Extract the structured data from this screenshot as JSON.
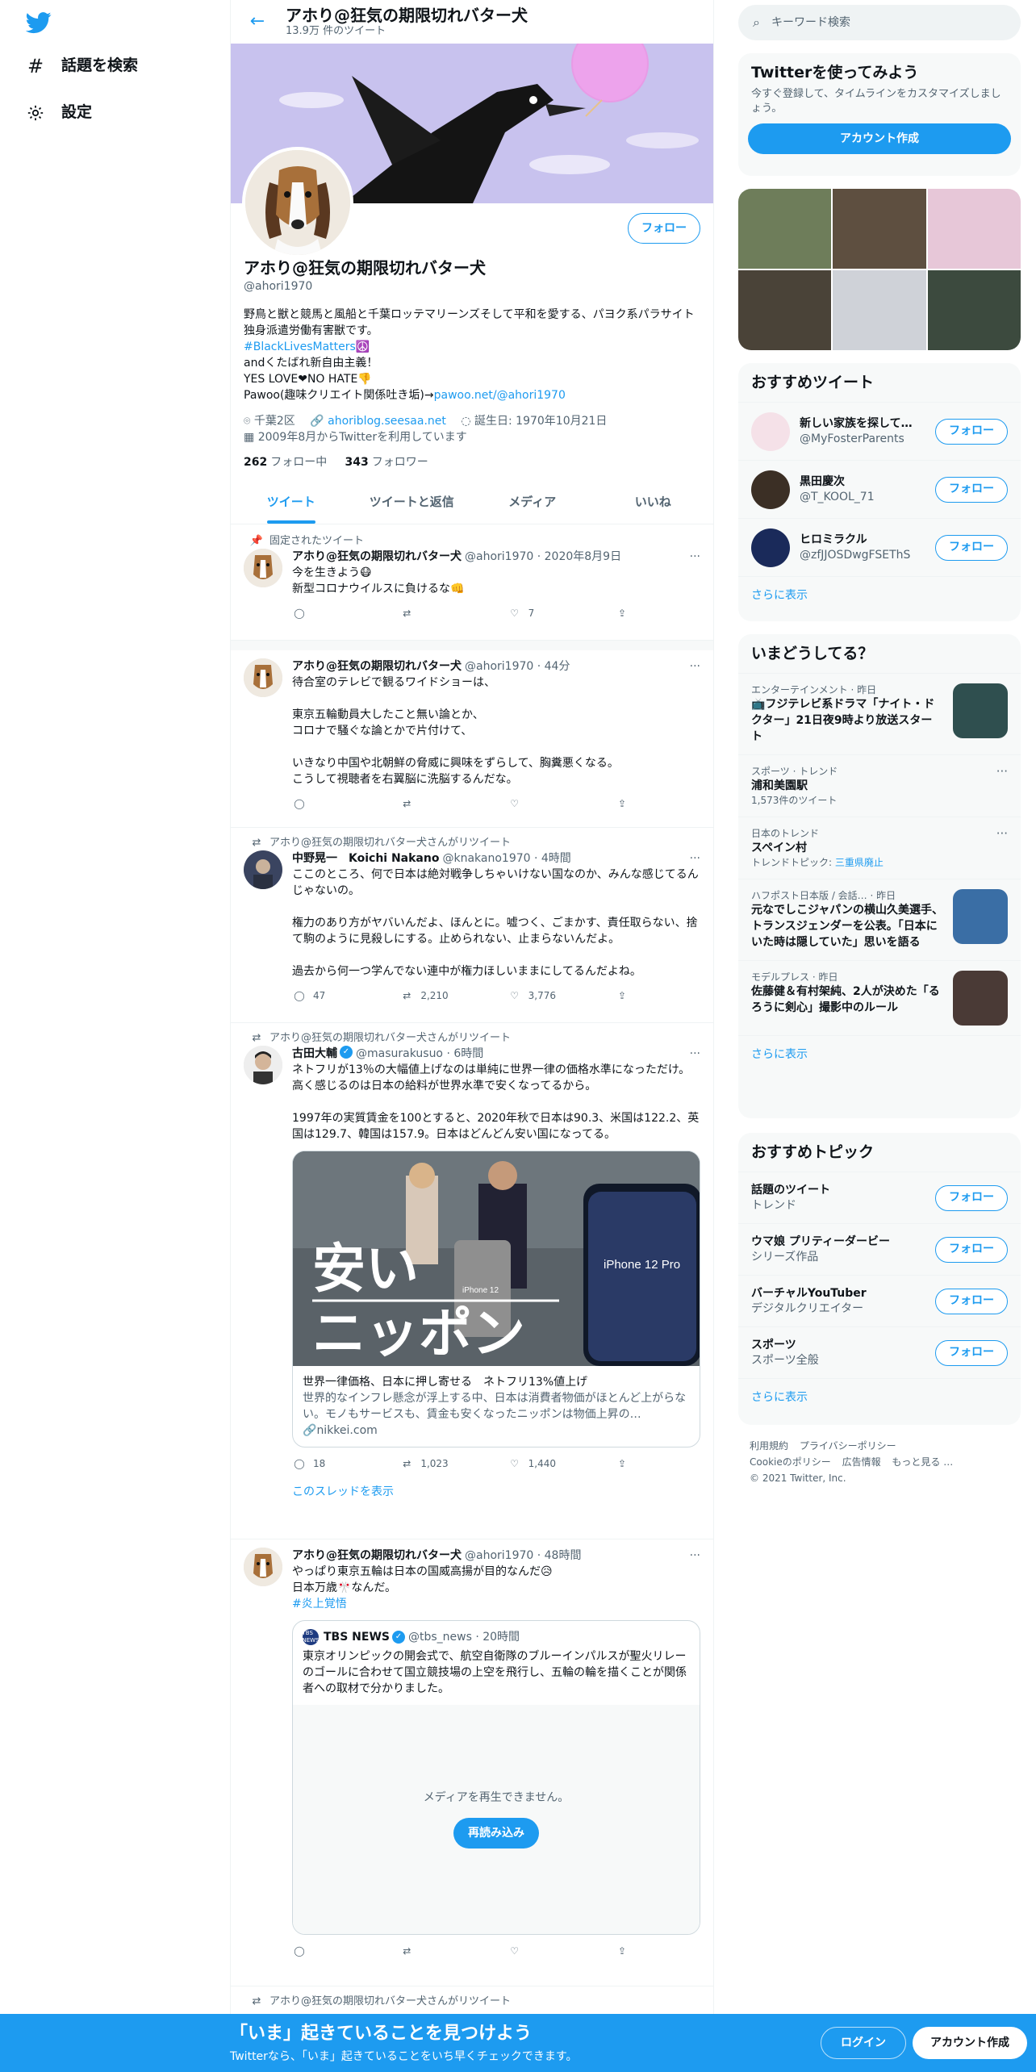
{
  "nav": {
    "explore": "話題を検索",
    "settings": "設定"
  },
  "header": {
    "title": "アホり@狂気の期限切れバター犬",
    "tweet_count": "13.9万 件のツイート"
  },
  "profile": {
    "follow": "フォロー",
    "name": "アホり@狂気の期限切れバター犬",
    "handle": "@ahori1970",
    "bio_line1": "野鳥と獣と競馬と風船と千葉ロッテマリーンズそして平和を愛する、パヨク系パラサイト独身派遣労働有害獣です。",
    "bio_hashtag": "#BlackLivesMatters☮️",
    "bio_line3": "andくたばれ新自由主義！",
    "bio_line4": "YES LOVE❤NO HATE👎",
    "bio_line5_prefix": "Pawoo(趣味クリエイト関係吐き垢)→",
    "bio_line5_link": "pawoo.net/@ahori1970",
    "location": "千葉2区",
    "website": "ahoriblog.seesaa.net",
    "birthday": "誕生日: 1970年10月21日",
    "joined": "2009年8月からTwitterを利用しています",
    "following_count": "262",
    "following_label": "フォロー中",
    "followers_count": "343",
    "followers_label": "フォロワー"
  },
  "tabs": [
    "ツイート",
    "ツイートと返信",
    "メディア",
    "いいね"
  ],
  "tweets": [
    {
      "context": "固定されたツイート",
      "name": "アホり@狂気の期限切れバター犬",
      "meta": "@ahori1970 · 2020年8月9日",
      "text": "今を生きよう😷\n新型コロナウイルスに負けるな👊",
      "reply": "",
      "retweet": "",
      "like": "7"
    },
    {
      "name": "アホり@狂気の期限切れバター犬",
      "meta": "@ahori1970 · 44分",
      "text": "待合室のテレビで観るワイドショーは、\n\n東京五輪動員大したこと無い論とか、\nコロナで騒ぐな論とかで片付けて、\n\nいきなり中国や北朝鮮の脅威に興味をずらして、胸糞悪くなる。\nこうして視聴者を右翼脳に洗脳するんだな。"
    },
    {
      "context": "アホり@狂気の期限切れバター犬さんがリツイート",
      "name": "中野晃一　Koichi Nakano",
      "meta": "@knakano1970 · 4時間",
      "text": "ここのところ、何で日本は絶対戦争しちゃいけない国なのか、みんな感じてるんじゃないの。\n\n権力のあり方がヤバいんだよ、ほんとに。嘘つく、ごまかす、責任取らない、捨て駒のように見殺しにする。止められない、止まらないんだよ。\n\n過去から何一つ学んでない連中が権力ほしいままにしてるんだよね。",
      "reply": "47",
      "retweet": "2,210",
      "like": "3,776"
    },
    {
      "context": "アホり@狂気の期限切れバター犬さんがリツイート",
      "name": "古田大輔",
      "meta": "@masurakusuo · 6時間",
      "text": "ネトフリが13％の大幅値上げなのは単純に世界一律の価格水準になっただけ。高く感じるのは日本の給料が世界水準で安くなってるから。\n\n1997年の実質賃金を100とすると、2020年秋で日本は90.3、米国は122.2、英国は129.7、韓国は157.9。日本はどんどん安い国になってる。",
      "card_overlay1": "安い",
      "card_overlay2": "ニッポン",
      "card_phone1": "iPhone 12",
      "card_phone2": "iPhone 12 Pro",
      "card_title": "世界一律価格、日本に押し寄せる　ネトフリ13%値上げ",
      "card_desc": "世界的なインフレ懸念が浮上する中、日本は消費者物価がほとんど上がらない。モノもサービスも、賃金も安くなったニッポンは物価上昇の…",
      "card_domain": "nikkei.com",
      "reply": "18",
      "retweet": "1,023",
      "like": "1,440",
      "show_thread": "このスレッドを表示"
    },
    {
      "name": "アホり@狂気の期限切れバター犬",
      "meta": "@ahori1970 · 48時間",
      "text": "やっぱり東京五輪は日本の国威高揚が目的なんだ😥\n日本万歳🎌なんだ。",
      "hashtag": "#炎上覚悟",
      "quote_avatar": "TBS NEWS",
      "quote_name": "TBS NEWS",
      "quote_meta": "@tbs_news · 20時間",
      "quote_text": "東京オリンピックの開会式で、航空自衛隊のブルーインパルスが聖火リレーのゴールに合わせて国立競技場の上空を飛行し、五輪の輪を描くことが関係者への取材で分かりました。",
      "media_error": "メディアを再生できません。",
      "reload": "再読み込み"
    },
    {
      "context": "アホり@狂気の期限切れバター犬さんがリツイート"
    }
  ],
  "sidebar": {
    "search_placeholder": "キーワード検索",
    "signup_title": "Twitterを使ってみよう",
    "signup_desc": "今すぐ登録して、タイムラインをカスタマイズしましょう。",
    "signup_button": "アカウント作成",
    "rec_title": "おすすめツイート",
    "recs": [
      {
        "name": "新しい家族を探して…",
        "handle": "@MyFosterParents",
        "follow": "フォロー"
      },
      {
        "name": "黒田慶次",
        "handle": "@T_KOOL_71",
        "follow": "フォロー"
      },
      {
        "name": "ヒロミラクル",
        "handle": "@zfJJOSDwgFSEThS",
        "follow": "フォロー"
      }
    ],
    "more": "さらに表示",
    "trends_title": "いまどうしてる？",
    "trends": [
      {
        "meta": "エンターテインメント · 昨日",
        "name": "📺フジテレビ系ドラマ「ナイト・ドクター」21日夜9時より放送スタート"
      },
      {
        "meta": "スポーツ · トレンド",
        "name": "浦和美園駅",
        "count": "1,573件のツイート"
      },
      {
        "meta": "日本のトレンド",
        "name": "スペイン村",
        "count_prefix": "トレンドトピック: ",
        "count_link": "三重県廃止"
      },
      {
        "meta": "ハフポスト日本版 / 会話… · 昨日",
        "name": "元なでしこジャパンの横山久美選手、トランスジェンダーを公表。「日本にいた時は隠していた」思いを語る"
      },
      {
        "meta": "モデルプレス · 昨日",
        "name": "佐藤健＆有村架純、2人が決めた「るろうに剣心」撮影中のルール"
      }
    ],
    "topics_title": "おすすめトピック",
    "topics": [
      {
        "name": "話題のツイート",
        "cat": "トレンド",
        "follow": "フォロー"
      },
      {
        "name": "ウマ娘 プリティーダービー",
        "cat": "シリーズ作品",
        "follow": "フォロー"
      },
      {
        "name": "バーチャルYouTuber",
        "cat": "デジタルクリエイター",
        "follow": "フォロー"
      },
      {
        "name": "スポーツ",
        "cat": "スポーツ全般",
        "follow": "フォロー"
      }
    ],
    "footer": [
      "利用規約",
      "プライバシーポリシー",
      "Cookieのポリシー",
      "広告情報",
      "もっと見る …",
      "© 2021 Twitter, Inc."
    ]
  },
  "bottom_bar": {
    "title": "「いま」起きていることを見つけよう",
    "subtitle": "Twitterなら、「いま」起きていることをいち早くチェックできます。",
    "login": "ログイン",
    "signup": "アカウント作成"
  },
  "colors": {
    "accent": "#1d9bf0",
    "text": "#0f1419",
    "muted": "#536471",
    "banner": "#c7c1ef"
  }
}
